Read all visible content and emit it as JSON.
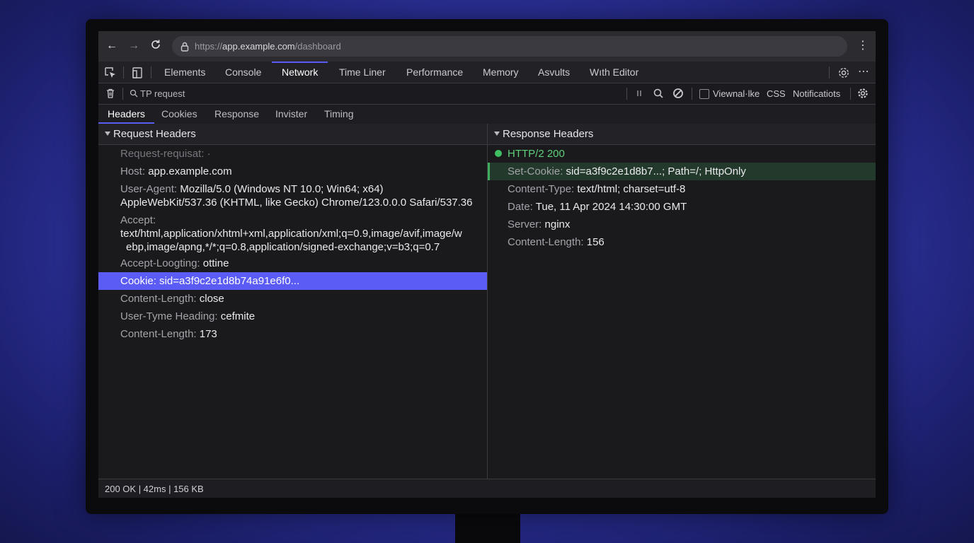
{
  "browser": {
    "url_prefix": "https://",
    "url_host": "app.example.com",
    "url_path": "/dashboard"
  },
  "devtools": {
    "tabs": [
      "Elements",
      "Console",
      "Network",
      "Time Liner",
      "Performance",
      "Memory",
      "Asvults",
      "Wıth Editor"
    ],
    "active_tab": "Network"
  },
  "filter": {
    "text": "TP request",
    "checkbox_label": "Viewnal·lke",
    "css_label": "CSS",
    "notifications_label": "Notificatiots"
  },
  "subtabs": {
    "items": [
      "Headers",
      "Cookies",
      "Response",
      "Invister",
      "Timing"
    ],
    "active": "Headers"
  },
  "request_headers": {
    "title": "Request Headers",
    "rows": [
      {
        "key": "Request-requisat:",
        "value": "·"
      },
      {
        "key": "Host:",
        "value": "app.example.com"
      },
      {
        "key": "User-Agent:",
        "value": "Mozilla/5.0 (Windows NT 10.0; Win64; x64)",
        "value2": "AppleWebKit/537.36 (KHTML, like Gecko) Chrome/123.0.0.0 Safari/537.36"
      },
      {
        "key": "Accept:",
        "value": "text/html,application/xhtml+xml,application/xml;q=0.9,image/avif,image/w",
        "value2": "ebp,image/apng,*/*;q=0.8,application/signed-exchange;v=b3;q=0.7"
      },
      {
        "key": "Accept-Loogting:",
        "value": "ottine"
      },
      {
        "key": "Cookie:",
        "value": "sid=a3f9c2e1d8b74a91e6f0..."
      },
      {
        "key": "Content-Length:",
        "value": "close"
      },
      {
        "key": "User-Tyme Heading:",
        "value": "cefmite"
      },
      {
        "key": "Content-Length:",
        "value": "173"
      }
    ]
  },
  "response_headers": {
    "title": "Response Headers",
    "status": "HTTP/2 200",
    "rows": [
      {
        "key": "Set-Cookie:",
        "value": "sid=a3f9c2e1d8b7...; Path=/; HttpOnly"
      },
      {
        "key": "Content-Type:",
        "value": "text/html; charset=utf-8"
      },
      {
        "key": "Date:",
        "value": "Tue, 11 Apr 2024 14:30:00 GMT"
      },
      {
        "key": "Server:",
        "value": "nginx"
      },
      {
        "key": "Content-Length:",
        "value": "156"
      }
    ]
  },
  "statusbar": {
    "text": "200 OK | 42ms | 156 KB"
  },
  "colors": {
    "accent": "#5b5cf6",
    "success": "#3fbf62",
    "panel_bg": "#1a1a1d"
  }
}
